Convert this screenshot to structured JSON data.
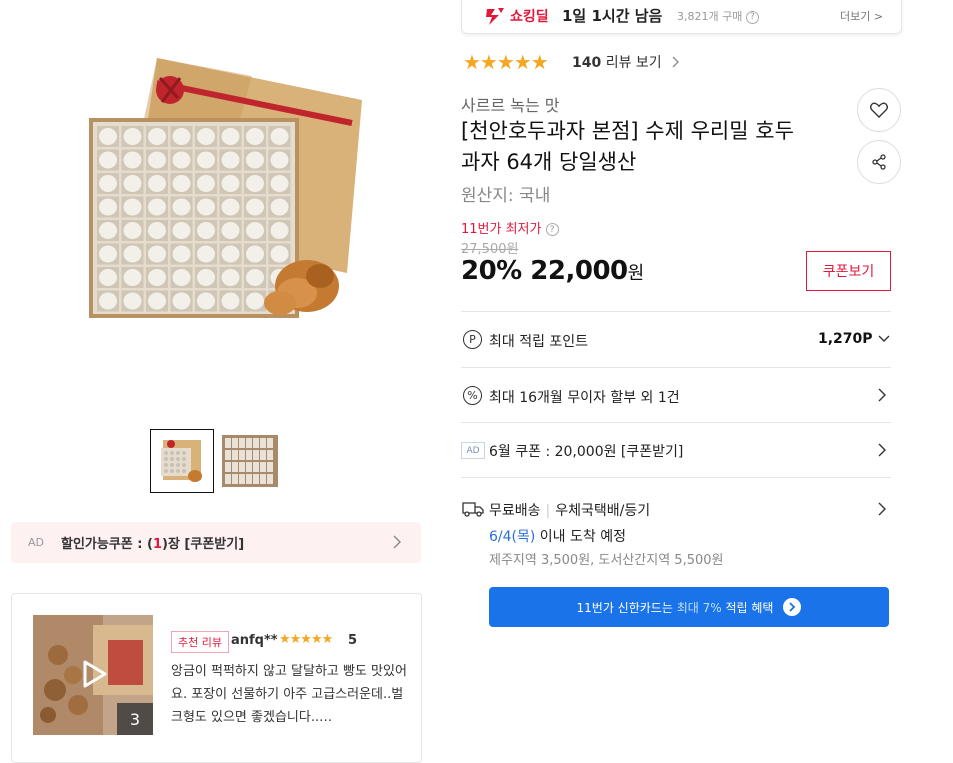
{
  "deal": {
    "label": "쇼킹딜",
    "time": "1일 1시간 남음",
    "purchase_count": "3,821개 구매",
    "more": "더보기 >"
  },
  "rating": {
    "stars": "★★★★★",
    "count": "140",
    "review_label": "리뷰 보기"
  },
  "product": {
    "subtitle": "사르르 녹는 맛",
    "title_line1": "[천안호두과자 본점] 수제 우리밀 호두",
    "title_line2": "과자 64개 당일생산",
    "origin": "원산지: 국내"
  },
  "price": {
    "lowest_label": "11번가 최저가",
    "original": "27,500원",
    "discount": "20%",
    "sale": "22,000",
    "won": "원",
    "coupon_button": "쿠폰보기"
  },
  "rows": {
    "points_label": "최대 적립 포인트",
    "points_value": "1,270P",
    "installment": "최대 16개월 무이자 할부 외 1건",
    "ad_tag": "AD",
    "june_coupon": "6월 쿠폰 : 20,000원 [쿠폰받기]"
  },
  "shipping": {
    "free": "무료배송",
    "method": "우체국택배/등기",
    "date": "6/4(목)",
    "arrival": "이내 도착 예정",
    "extra": "제주지역 3,500원, 도서산간지역 5,500원"
  },
  "card_banner": {
    "prefix": "11번가 신한카드는",
    "highlight": "최대 7%",
    "suffix": "적립 혜택"
  },
  "coupon_bar": {
    "ad": "AD",
    "prefix": "할인가능쿠폰 : (",
    "count": "1",
    "suffix": ")장 [쿠폰받기]"
  },
  "review": {
    "badge": "추천 리뷰",
    "reviewer": "anfq**",
    "stars": "★★★★★",
    "score": "5",
    "text": "앙금이 퍽퍽하지 않고 달달하고 빵도 맛있어요. 포장이 선물하기 아주 고급스러운데..벌크형도 있으면 좋겠습니다..…",
    "image_count": "3"
  },
  "colors": {
    "accent_red": "#e0193b",
    "star": "#f5a623",
    "blue": "#1a73e8"
  }
}
